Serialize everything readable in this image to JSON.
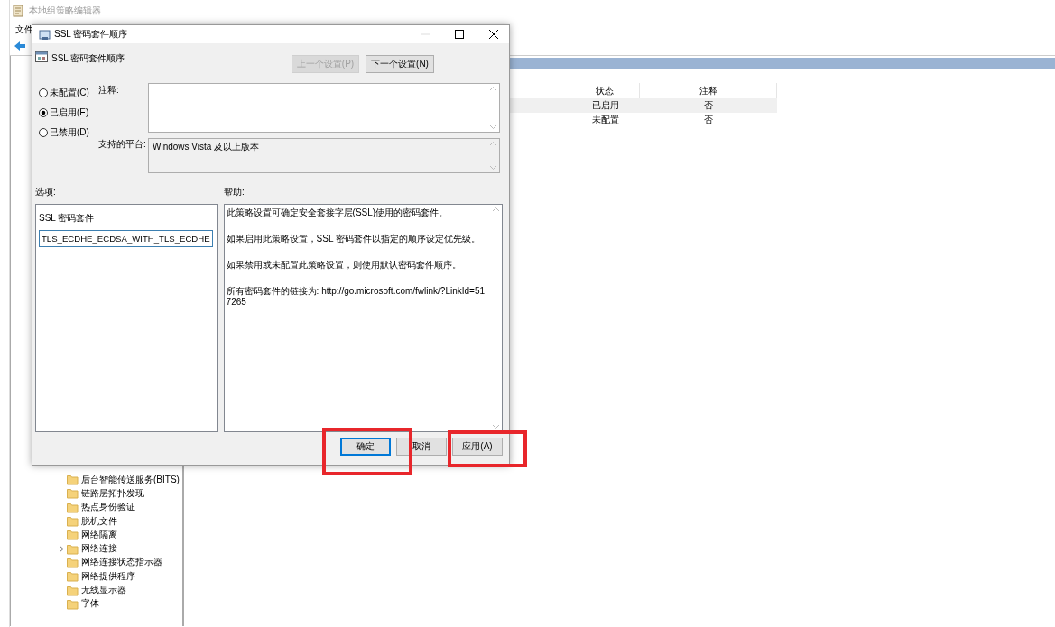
{
  "editor": {
    "title": "本地组策略编辑器",
    "menu": [
      "文件"
    ],
    "tree": [
      {
        "label": "后台智能传送服务(BITS)",
        "expandable": false
      },
      {
        "label": "链路层拓扑发现",
        "expandable": false
      },
      {
        "label": "热点身份验证",
        "expandable": false
      },
      {
        "label": "脱机文件",
        "expandable": false
      },
      {
        "label": "网络隔离",
        "expandable": false
      },
      {
        "label": "网络连接",
        "expandable": true
      },
      {
        "label": "网络连接状态指示器",
        "expandable": false
      },
      {
        "label": "网络提供程序",
        "expandable": false
      },
      {
        "label": "无线显示器",
        "expandable": false
      },
      {
        "label": "字体",
        "expandable": false
      }
    ],
    "table": {
      "columns": [
        "状态",
        "注释"
      ],
      "rows": [
        {
          "cells": [
            "已启用",
            "否"
          ],
          "selected": true
        },
        {
          "cells": [
            "未配置",
            "否"
          ],
          "selected": false
        }
      ]
    }
  },
  "dialog": {
    "title": "SSL 密码套件顺序",
    "heading": "SSL 密码套件顺序",
    "nav_buttons": [
      {
        "label": "上一个设置(P)",
        "disabled": true
      },
      {
        "label": "下一个设置(N)",
        "disabled": false
      }
    ],
    "radios": [
      {
        "label": "未配置(C)",
        "selected": false
      },
      {
        "label": "已启用(E)",
        "selected": true
      },
      {
        "label": "已禁用(D)",
        "selected": false
      }
    ],
    "comment_label": "注释:",
    "platform_label": "支持的平台:",
    "platform": "Windows Vista 及以上版本",
    "options_label": "选项:",
    "help_label": "帮助:",
    "option_title": "SSL 密码套件",
    "option_value": "TLS_ECDHE_ECDSA_WITH_TLS_ECDHE",
    "help": [
      "此策略设置可确定安全套接字层(SSL)使用的密码套件。",
      "如果启用此策略设置，SSL 密码套件以指定的顺序设定优先级。",
      "如果禁用或未配置此策略设置，则使用默认密码套件顺序。",
      "所有密码套件的链接为: http://go.microsoft.com/fwlink/?LinkId=517265"
    ],
    "buttons": [
      {
        "label": "确定",
        "default": true
      },
      {
        "label": "取消",
        "default": false
      },
      {
        "label": "应用(A)",
        "default": false
      }
    ]
  }
}
